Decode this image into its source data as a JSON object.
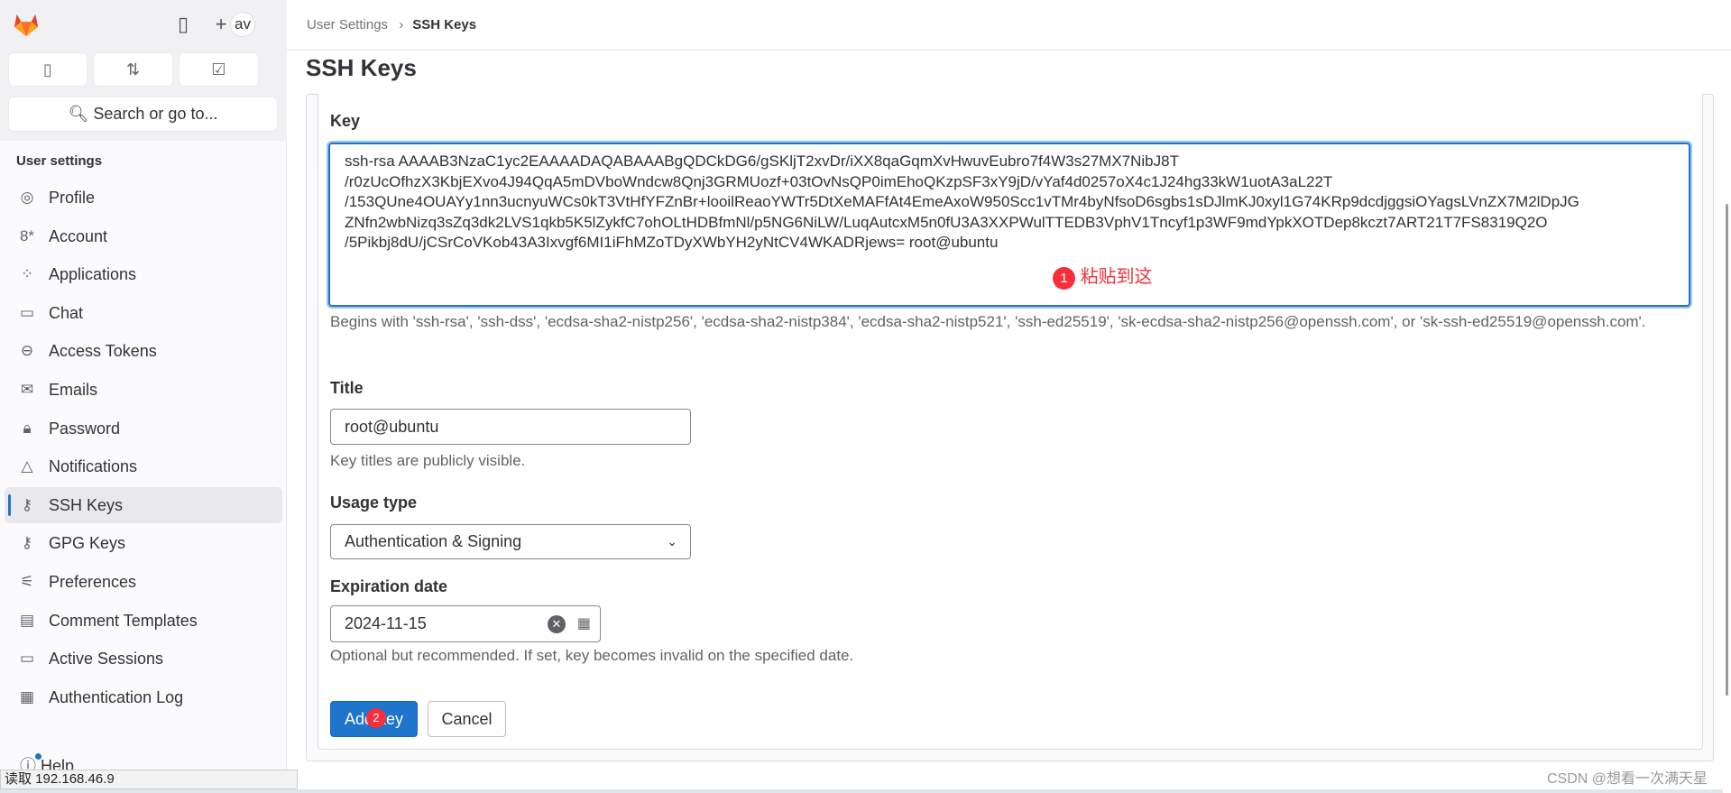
{
  "sidebar": {
    "avatar": "av",
    "search": "Search or go to...",
    "heading": "User settings",
    "items": [
      {
        "label": "Profile",
        "icon": "profile-icon",
        "glyph": "◎"
      },
      {
        "label": "Account",
        "icon": "account-icon",
        "glyph": "8*"
      },
      {
        "label": "Applications",
        "icon": "applications-icon",
        "glyph": "⁘"
      },
      {
        "label": "Chat",
        "icon": "chat-icon",
        "glyph": "▭"
      },
      {
        "label": "Access Tokens",
        "icon": "token-icon",
        "glyph": "⊖"
      },
      {
        "label": "Emails",
        "icon": "mail-icon",
        "glyph": "✉"
      },
      {
        "label": "Password",
        "icon": "lock-icon",
        "glyph": "🔒︎"
      },
      {
        "label": "Notifications",
        "icon": "bell-icon",
        "glyph": "△"
      },
      {
        "label": "SSH Keys",
        "icon": "key-icon",
        "glyph": "⚷"
      },
      {
        "label": "GPG Keys",
        "icon": "key-icon",
        "glyph": "⚷"
      },
      {
        "label": "Preferences",
        "icon": "preferences-icon",
        "glyph": "⚟"
      },
      {
        "label": "Comment Templates",
        "icon": "comment-icon",
        "glyph": "▤"
      },
      {
        "label": "Active Sessions",
        "icon": "monitor-icon",
        "glyph": "▭"
      },
      {
        "label": "Authentication Log",
        "icon": "log-icon",
        "glyph": "▦"
      }
    ],
    "help": "Help"
  },
  "breadcrumb": {
    "parent": "User Settings",
    "separator": "›",
    "current": "SSH Keys"
  },
  "page_title": "SSH Keys",
  "form": {
    "key_label": "Key",
    "key_value": "ssh-rsa AAAAB3NzaC1yc2EAAAADAQABAAABgQDCkDG6/gSKljT2xvDr/iXX8qaGqmXvHwuvEubro7f4W3s27MX7NibJ8T\n/r0zUcOfhzX3KbjEXvo4J94QqA5mDVboWndcw8Qnj3GRMUozf+03tOvNsQP0imEhoQKzpSF3xY9jD/vYaf4d0257oX4c1J24hg33kW1uotA3aL22T\n/153QUne4OUAYy1nn3ucnyuWCs0kT3VtHfYFZnBr+looilReaoYWTr5DtXeMAFfAt4EmeAxoW950Scc1vTMr4byNfsoD6sgbs1sDJlmKJ0xyl1G74KRp9dcdjggsiOYagsLVnZX7M2lDpJG\nZNfn2wbNizq3sZq3dk2LVS1qkb5K5lZykfC7ohOLtHDBfmNl/p5NG6NiLW/LuqAutcxM5n0fU3A3XXPWulTTEDB3VphV1Tncyf1p3WF9mdYpkXOTDep8kczt7ART21T7FS8319Q2O\n/5Pikbj8dU/jCSrCoVKob43A3Ixvgf6MI1iFhMZoTDyXWbYH2yNtCV4WKADRjews= root@ubuntu",
    "key_help": "Begins with 'ssh-rsa', 'ssh-dss', 'ecdsa-sha2-nistp256', 'ecdsa-sha2-nistp384', 'ecdsa-sha2-nistp521', 'ssh-ed25519', 'sk-ecdsa-sha2-nistp256@openssh.com', or 'sk-ssh-ed25519@openssh.com'.",
    "title_label": "Title",
    "title_value": "root@ubuntu",
    "title_help": "Key titles are publicly visible.",
    "usage_label": "Usage type",
    "usage_value": "Authentication & Signing",
    "expiration_label": "Expiration date",
    "expiration_value": "2024-11-15",
    "expiration_help": "Optional but recommended. If set, key becomes invalid on the specified date.",
    "add_label": "Add key",
    "cancel_label": "Cancel"
  },
  "annotations": {
    "step1_num": "1",
    "step1_text": "粘贴到这",
    "step2_num": "2"
  },
  "status_bar": "读取 192.168.46.9",
  "watermark": "CSDN @想看一次满天星",
  "colors": {
    "primary": "#1f75cb",
    "badge": "#f5303a"
  }
}
